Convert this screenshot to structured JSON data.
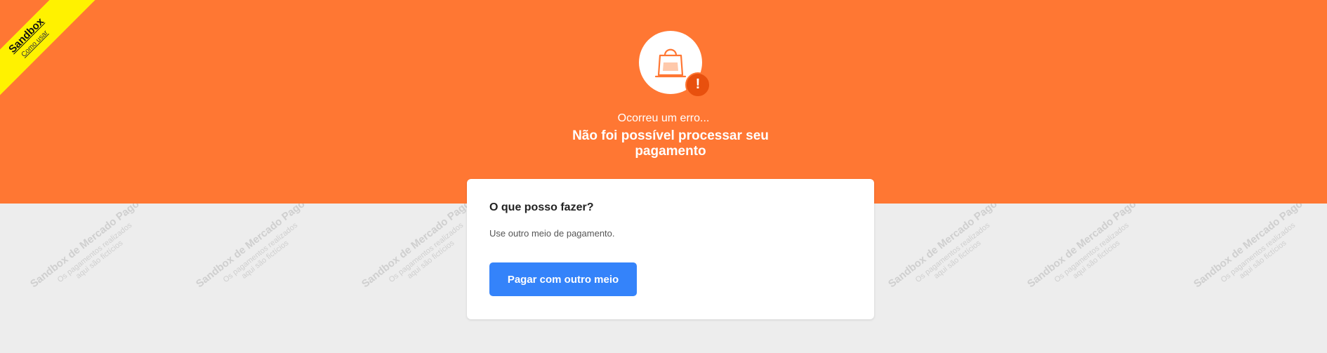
{
  "sandbox_ribbon": {
    "title": "Sandbox",
    "link": "Como usar"
  },
  "watermark": {
    "line1": "Sandbox de Mercado Pago",
    "line2": "Os pagamentos realizados",
    "line3": "aqui são fictícios"
  },
  "status": {
    "icon": "shopping-bag-icon",
    "badge_icon": "alert-icon",
    "badge_symbol": "!",
    "subtitle": "Ocorreu um erro...",
    "title": "Não foi possível processar seu pagamento"
  },
  "card": {
    "title": "O que posso fazer?",
    "text": "Use outro meio de pagamento.",
    "button_label": "Pagar com outro meio"
  },
  "colors": {
    "header": "#ff7733",
    "background": "#ededed",
    "button": "#3483fa",
    "badge": "#e8500e",
    "ribbon": "#fff200"
  }
}
